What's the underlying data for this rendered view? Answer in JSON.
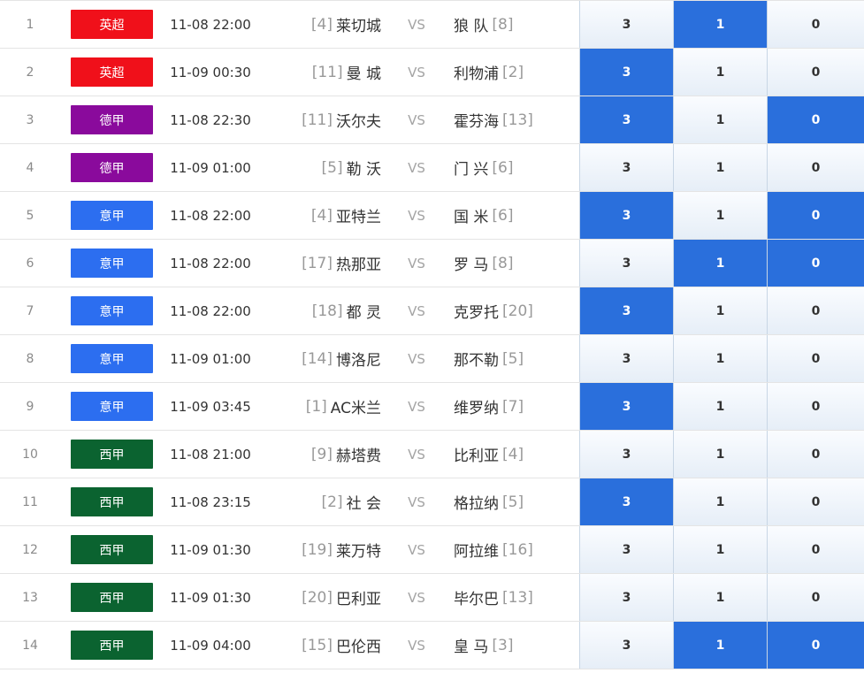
{
  "colors": {
    "英超": "#f0101a",
    "德甲": "#8a0a9c",
    "意甲": "#2c6ef0",
    "西甲": "#0b6330",
    "selected": "#2a6fdc"
  },
  "matches": [
    {
      "idx": "1",
      "league": "英超",
      "time": "11-08 22:00",
      "home_rank": "[4]",
      "home": "莱切城",
      "vs": "VS",
      "away": "狼 队",
      "away_rank": "[8]",
      "odds": [
        "3",
        "1",
        "0"
      ],
      "selected": [
        false,
        true,
        false
      ]
    },
    {
      "idx": "2",
      "league": "英超",
      "time": "11-09 00:30",
      "home_rank": "[11]",
      "home": "曼 城",
      "vs": "VS",
      "away": "利物浦",
      "away_rank": "[2]",
      "odds": [
        "3",
        "1",
        "0"
      ],
      "selected": [
        true,
        false,
        false
      ]
    },
    {
      "idx": "3",
      "league": "德甲",
      "time": "11-08 22:30",
      "home_rank": "[11]",
      "home": "沃尔夫",
      "vs": "VS",
      "away": "霍芬海",
      "away_rank": "[13]",
      "odds": [
        "3",
        "1",
        "0"
      ],
      "selected": [
        true,
        false,
        true
      ]
    },
    {
      "idx": "4",
      "league": "德甲",
      "time": "11-09 01:00",
      "home_rank": "[5]",
      "home": "勒 沃",
      "vs": "VS",
      "away": "门 兴",
      "away_rank": "[6]",
      "odds": [
        "3",
        "1",
        "0"
      ],
      "selected": [
        false,
        false,
        false
      ]
    },
    {
      "idx": "5",
      "league": "意甲",
      "time": "11-08 22:00",
      "home_rank": "[4]",
      "home": "亚特兰",
      "vs": "VS",
      "away": "国 米",
      "away_rank": "[6]",
      "odds": [
        "3",
        "1",
        "0"
      ],
      "selected": [
        true,
        false,
        true
      ]
    },
    {
      "idx": "6",
      "league": "意甲",
      "time": "11-08 22:00",
      "home_rank": "[17]",
      "home": "热那亚",
      "vs": "VS",
      "away": "罗 马",
      "away_rank": "[8]",
      "odds": [
        "3",
        "1",
        "0"
      ],
      "selected": [
        false,
        true,
        true
      ]
    },
    {
      "idx": "7",
      "league": "意甲",
      "time": "11-08 22:00",
      "home_rank": "[18]",
      "home": "都 灵",
      "vs": "VS",
      "away": "克罗托",
      "away_rank": "[20]",
      "odds": [
        "3",
        "1",
        "0"
      ],
      "selected": [
        true,
        false,
        false
      ]
    },
    {
      "idx": "8",
      "league": "意甲",
      "time": "11-09 01:00",
      "home_rank": "[14]",
      "home": "博洛尼",
      "vs": "VS",
      "away": "那不勒",
      "away_rank": "[5]",
      "odds": [
        "3",
        "1",
        "0"
      ],
      "selected": [
        false,
        false,
        false
      ]
    },
    {
      "idx": "9",
      "league": "意甲",
      "time": "11-09 03:45",
      "home_rank": "[1]",
      "home": "AC米兰",
      "vs": "VS",
      "away": "维罗纳",
      "away_rank": "[7]",
      "odds": [
        "3",
        "1",
        "0"
      ],
      "selected": [
        true,
        false,
        false
      ]
    },
    {
      "idx": "10",
      "league": "西甲",
      "time": "11-08 21:00",
      "home_rank": "[9]",
      "home": "赫塔费",
      "vs": "VS",
      "away": "比利亚",
      "away_rank": "[4]",
      "odds": [
        "3",
        "1",
        "0"
      ],
      "selected": [
        false,
        false,
        false
      ]
    },
    {
      "idx": "11",
      "league": "西甲",
      "time": "11-08 23:15",
      "home_rank": "[2]",
      "home": "社 会",
      "vs": "VS",
      "away": "格拉纳",
      "away_rank": "[5]",
      "odds": [
        "3",
        "1",
        "0"
      ],
      "selected": [
        true,
        false,
        false
      ]
    },
    {
      "idx": "12",
      "league": "西甲",
      "time": "11-09 01:30",
      "home_rank": "[19]",
      "home": "莱万特",
      "vs": "VS",
      "away": "阿拉维",
      "away_rank": "[16]",
      "odds": [
        "3",
        "1",
        "0"
      ],
      "selected": [
        false,
        false,
        false
      ]
    },
    {
      "idx": "13",
      "league": "西甲",
      "time": "11-09 01:30",
      "home_rank": "[20]",
      "home": "巴利亚",
      "vs": "VS",
      "away": "毕尔巴",
      "away_rank": "[13]",
      "odds": [
        "3",
        "1",
        "0"
      ],
      "selected": [
        false,
        false,
        false
      ]
    },
    {
      "idx": "14",
      "league": "西甲",
      "time": "11-09 04:00",
      "home_rank": "[15]",
      "home": "巴伦西",
      "vs": "VS",
      "away": "皇 马",
      "away_rank": "[3]",
      "odds": [
        "3",
        "1",
        "0"
      ],
      "selected": [
        false,
        true,
        true
      ]
    }
  ]
}
